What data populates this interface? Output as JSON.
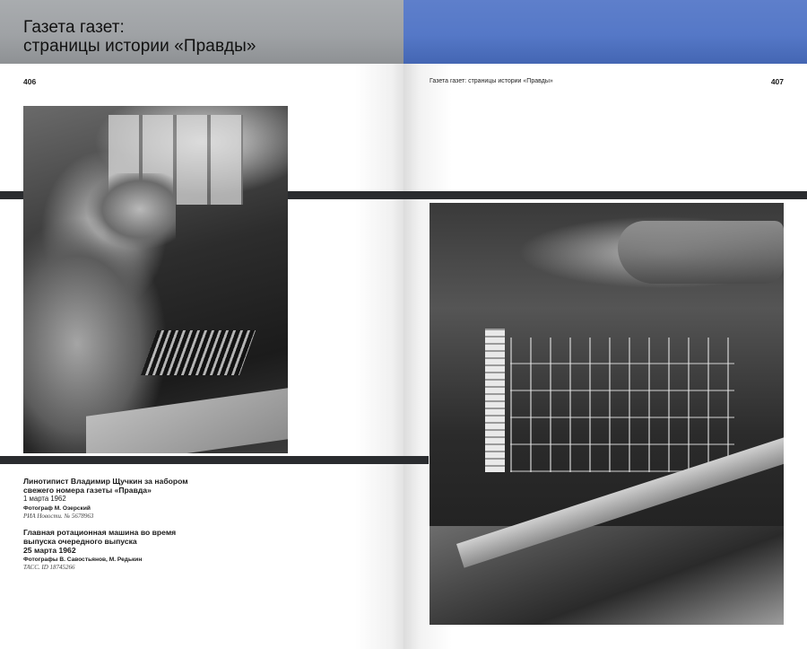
{
  "left_page": {
    "chapter_title_line1": "Газета газет:",
    "chapter_title_line2": "страницы истории «Правды»",
    "page_number": "406"
  },
  "right_page": {
    "running_head": "Газета газет: страницы истории «Правды»",
    "page_number": "407"
  },
  "captions": [
    {
      "title_line1": "Линотипист Владимир Щучкин за набором",
      "title_line2": "свежего номера газеты «Правда»",
      "date": "1 марта 1962",
      "photographer": "Фотограф М. Озерский",
      "source": "РИА Новости. № 5678963"
    },
    {
      "title_line1": "Главная ротационная машина во время",
      "title_line2": "выпуска очередного выпуска",
      "date": "25 марта 1962",
      "photographer": "Фотографы В. Савостьянов, М. Редькин",
      "source": "ТАСС. ID 18745266"
    }
  ],
  "colors": {
    "left_header": "#a3a6a9",
    "right_header": "#5577c6",
    "band": "#2a2c2f"
  }
}
